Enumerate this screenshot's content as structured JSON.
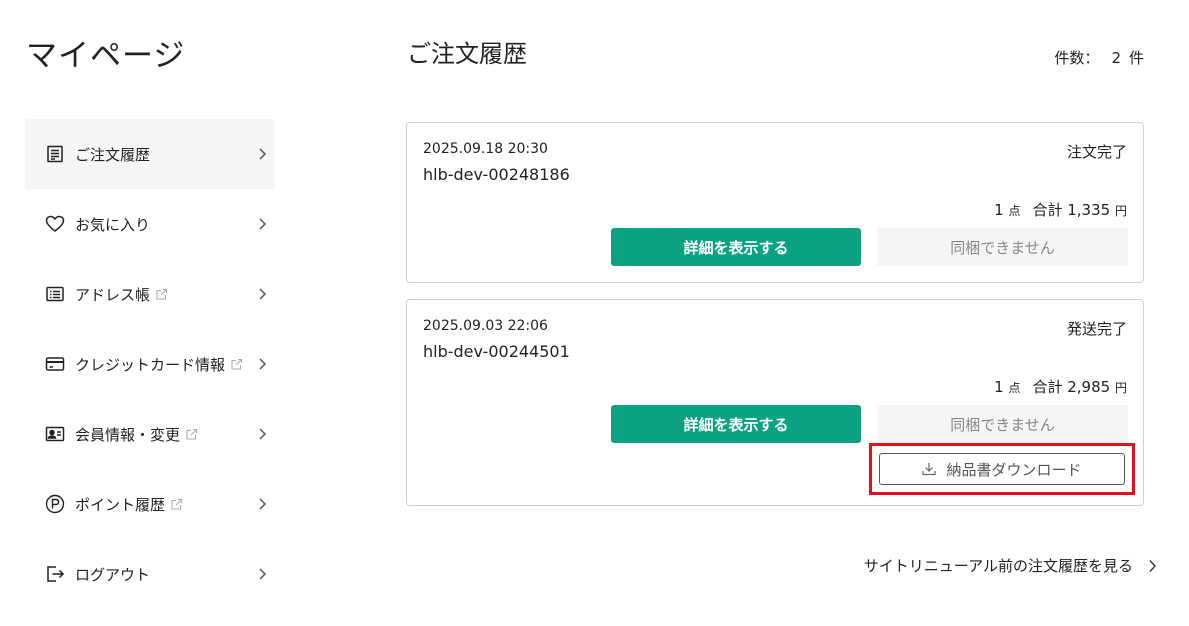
{
  "page_title": "マイページ",
  "sidebar": {
    "items": [
      {
        "label": "ご注文履歴",
        "icon": "receipt-icon",
        "active": true,
        "external": false
      },
      {
        "label": "お気に入り",
        "icon": "heart-icon",
        "active": false,
        "external": false
      },
      {
        "label": "アドレス帳",
        "icon": "address-book-icon",
        "active": false,
        "external": true
      },
      {
        "label": "クレジットカード情報",
        "icon": "credit-card-icon",
        "active": false,
        "external": true
      },
      {
        "label": "会員情報・変更",
        "icon": "id-card-icon",
        "active": false,
        "external": true
      },
      {
        "label": "ポイント履歴",
        "icon": "point-icon",
        "active": false,
        "external": true
      },
      {
        "label": "ログアウト",
        "icon": "logout-icon",
        "active": false,
        "external": false
      }
    ]
  },
  "main": {
    "title": "ご注文履歴",
    "count_label": "件数：",
    "count_value": "2",
    "count_unit": "件",
    "orders": [
      {
        "datetime": "2025.09.18 20:30",
        "order_id": "hlb-dev-00248186",
        "status": "注文完了",
        "qty": "1",
        "qty_unit": "点",
        "total_label": "合計",
        "total": "1,335",
        "currency": "円",
        "detail_label": "詳細を表示する",
        "bundle_label": "同梱できません"
      },
      {
        "datetime": "2025.09.03 22:06",
        "order_id": "hlb-dev-00244501",
        "status": "発送完了",
        "qty": "1",
        "qty_unit": "点",
        "total_label": "合計",
        "total": "2,985",
        "currency": "円",
        "detail_label": "詳細を表示する",
        "bundle_label": "同梱できません",
        "download_label": "納品書ダウンロード"
      }
    ],
    "old_history_label": "サイトリニューアル前の注文履歴を見る"
  },
  "colors": {
    "accent": "#0ba282",
    "highlight": "#e3101b",
    "active_bg": "#f5f5f5"
  }
}
